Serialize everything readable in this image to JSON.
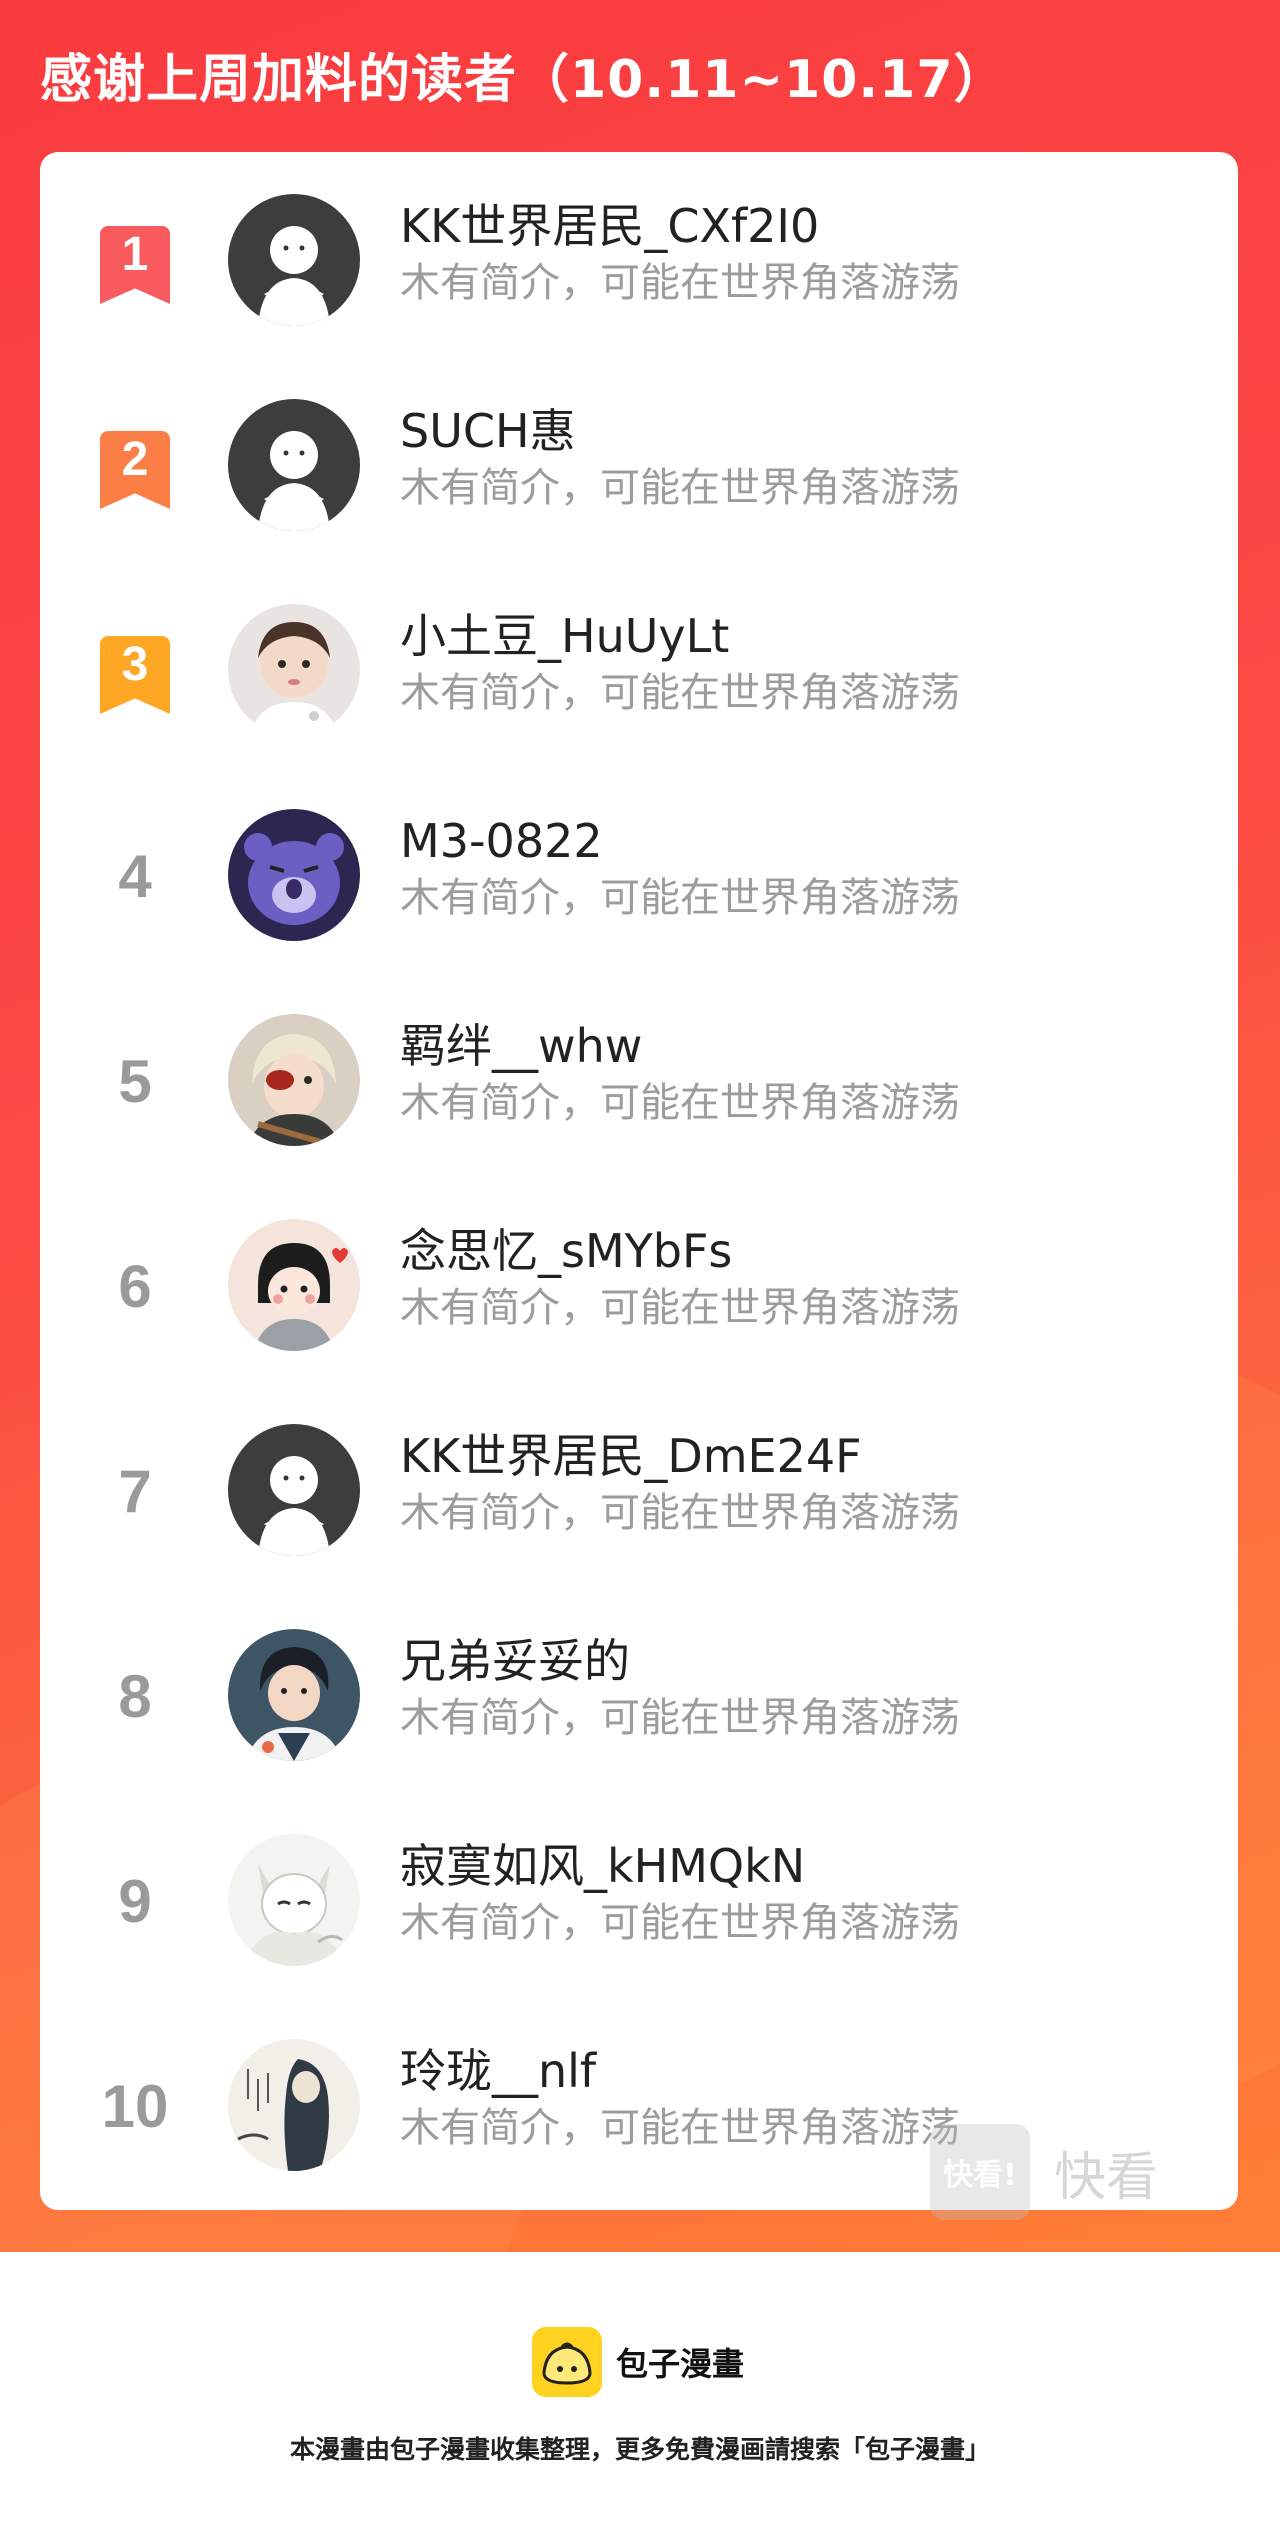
{
  "header": {
    "title": "感谢上周加料的读者（10.11~10.17）"
  },
  "colors": {
    "banner_red": "#fa3b3f",
    "banner_orange": "#ff7e35",
    "rank1": "#f85a5e",
    "rank2": "#fc7e47",
    "rank3": "#ffa724",
    "rank_gray": "#9a9a9a"
  },
  "readers": [
    {
      "rank": "1",
      "name": "KK世界居民_CXf2I0",
      "bio": "木有简介，可能在世界角落游荡",
      "avatar": "default-avatar-icon"
    },
    {
      "rank": "2",
      "name": "SUCH惠",
      "bio": "木有简介，可能在世界角落游荡",
      "avatar": "default-avatar-icon"
    },
    {
      "rank": "3",
      "name": "小土豆_HuUyLt",
      "bio": "木有简介，可能在世界角落游荡",
      "avatar": "child-photo-avatar"
    },
    {
      "rank": "4",
      "name": "M3-0822",
      "bio": "木有简介，可能在世界角落游荡",
      "avatar": "purple-bear-avatar"
    },
    {
      "rank": "5",
      "name": "羁绊__whw",
      "bio": "木有简介，可能在世界角落游荡",
      "avatar": "anime-boy-avatar"
    },
    {
      "rank": "6",
      "name": "念思忆_sMYbFs",
      "bio": "木有简介，可能在世界角落游荡",
      "avatar": "cartoon-girl-avatar"
    },
    {
      "rank": "7",
      "name": "KK世界居民_DmE24F",
      "bio": "木有简介，可能在世界角落游荡",
      "avatar": "default-avatar-icon"
    },
    {
      "rank": "8",
      "name": "兄弟妥妥的",
      "bio": "木有简介，可能在世界角落游荡",
      "avatar": "anime-man-avatar"
    },
    {
      "rank": "9",
      "name": "寂寞如风_kHMQkN",
      "bio": "木有简介，可能在世界角落游荡",
      "avatar": "white-fox-avatar"
    },
    {
      "rank": "10",
      "name": "玲珑__nlf",
      "bio": "木有简介，可能在世界角落游荡",
      "avatar": "ink-painting-avatar"
    }
  ],
  "watermark": {
    "box_label": "快看!",
    "text": "快看"
  },
  "footer": {
    "logo_text": "包子漫畫",
    "note": "本漫畫由包子漫畫收集整理，更多免費漫画請搜索「包子漫畫」"
  }
}
